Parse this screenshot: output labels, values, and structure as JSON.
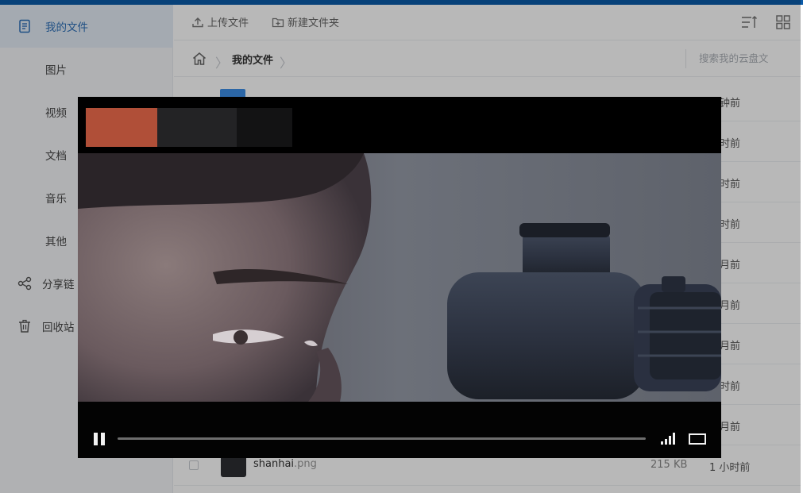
{
  "sidebar": {
    "items": [
      {
        "label": "我的文件",
        "icon": "document-icon",
        "active": true
      },
      {
        "label": "图片",
        "icon": "",
        "active": false
      },
      {
        "label": "视频",
        "icon": "",
        "active": false
      },
      {
        "label": "文档",
        "icon": "",
        "active": false
      },
      {
        "label": "音乐",
        "icon": "",
        "active": false
      },
      {
        "label": "其他",
        "icon": "",
        "active": false
      },
      {
        "label": "分享链",
        "icon": "share-icon",
        "active": false
      },
      {
        "label": "回收站",
        "icon": "trash-icon",
        "active": false
      }
    ]
  },
  "toolbar": {
    "upload_label": "上传文件",
    "new_folder_label": "新建文件夹"
  },
  "breadcrumb": {
    "current": "我的文件"
  },
  "search": {
    "placeholder": "搜索我的云盘文"
  },
  "files": [
    {
      "time": "分钟前"
    },
    {
      "time": "小时前"
    },
    {
      "time": "小时前"
    },
    {
      "time": "小时前"
    },
    {
      "time": "个月前"
    },
    {
      "time": "个月前"
    },
    {
      "time": "个月前"
    },
    {
      "time": "小时前"
    },
    {
      "time": "个月前"
    },
    {
      "name": "shanhai",
      "ext": ".png",
      "size": "215 KB",
      "time": "1 小时前"
    }
  ],
  "player": {
    "state": "playing",
    "progress_fraction": 0.0,
    "volume_level": 1.0
  },
  "colors": {
    "accent": "#2d6fb8",
    "topbar": "#0a5aa8",
    "folder": "#3c8ee6"
  }
}
